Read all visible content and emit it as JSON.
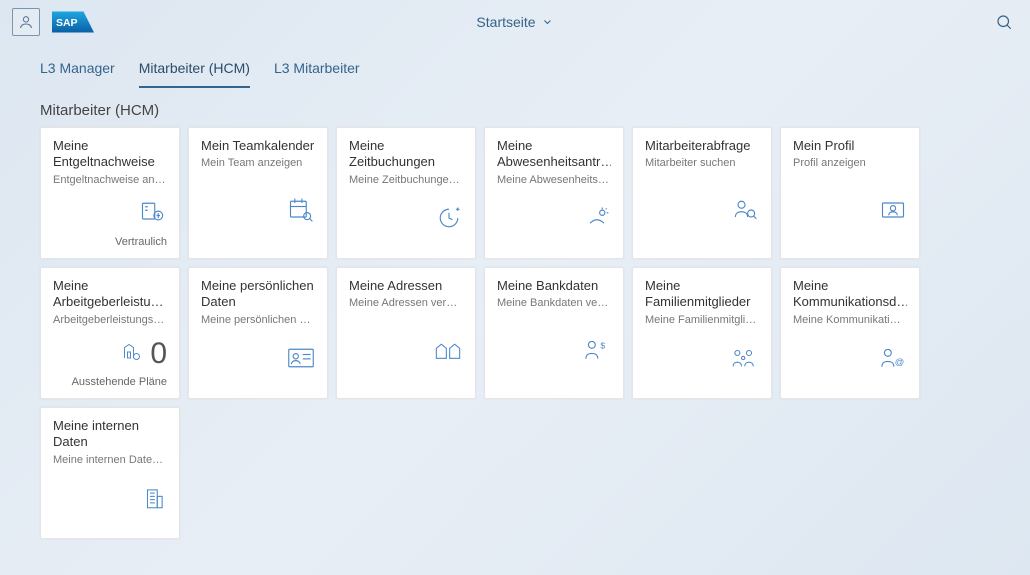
{
  "header": {
    "title": "Startseite"
  },
  "tabs": [
    {
      "label": "L3 Manager",
      "active": false
    },
    {
      "label": "Mitarbeiter (HCM)",
      "active": true
    },
    {
      "label": "L3 Mitarbeiter",
      "active": false
    }
  ],
  "section_title": "Mitarbeiter (HCM)",
  "tiles": [
    {
      "title": "Meine Entgeltnachweise",
      "subtitle": "Entgeltnachweise an…",
      "icon": "payslip-icon",
      "footer": "Vertraulich"
    },
    {
      "title": "Mein Teamkalender",
      "subtitle": "Mein Team anzeigen",
      "icon": "calendar-search-icon"
    },
    {
      "title": "Meine Zeitbuchungen",
      "subtitle": "Meine Zeitbuchunge…",
      "icon": "clock-icon"
    },
    {
      "title": "Meine Abwesenheitsantr…",
      "subtitle": "Meine Abwesenheits…",
      "icon": "sun-icon"
    },
    {
      "title": "Mitarbeiterabfrage",
      "subtitle": "Mitarbeiter suchen",
      "icon": "person-search-icon"
    },
    {
      "title": "Mein Profil",
      "subtitle": "Profil anzeigen",
      "icon": "profile-card-icon"
    },
    {
      "title": "Meine Arbeitgeberleistu…",
      "subtitle": "Arbeitgeberleistungs…",
      "icon": "benefits-icon",
      "number": "0",
      "footer": "Ausstehende Pläne"
    },
    {
      "title": "Meine persönlichen Daten",
      "subtitle": "Meine persönlichen …",
      "icon": "id-card-icon"
    },
    {
      "title": "Meine Adressen",
      "subtitle": "Meine Adressen ver…",
      "icon": "houses-icon"
    },
    {
      "title": "Meine Bankdaten",
      "subtitle": "Meine Bankdaten ve…",
      "icon": "person-money-icon"
    },
    {
      "title": "Meine Familienmitglieder",
      "subtitle": "Meine Familienmitgli…",
      "icon": "family-icon"
    },
    {
      "title": "Meine Kommunikationsd…",
      "subtitle": "Meine Kommunikati…",
      "icon": "person-email-icon"
    },
    {
      "title": "Meine internen Daten",
      "subtitle": "Meine internen Date…",
      "icon": "building-icon"
    }
  ],
  "icons": {
    "user-icon": "user",
    "chevron-down-icon": "chevron",
    "search-icon": "search"
  },
  "colors": {
    "accent": "#4d89c8",
    "text_primary": "#333",
    "text_muted": "#777",
    "tab_active": "#34648b"
  }
}
